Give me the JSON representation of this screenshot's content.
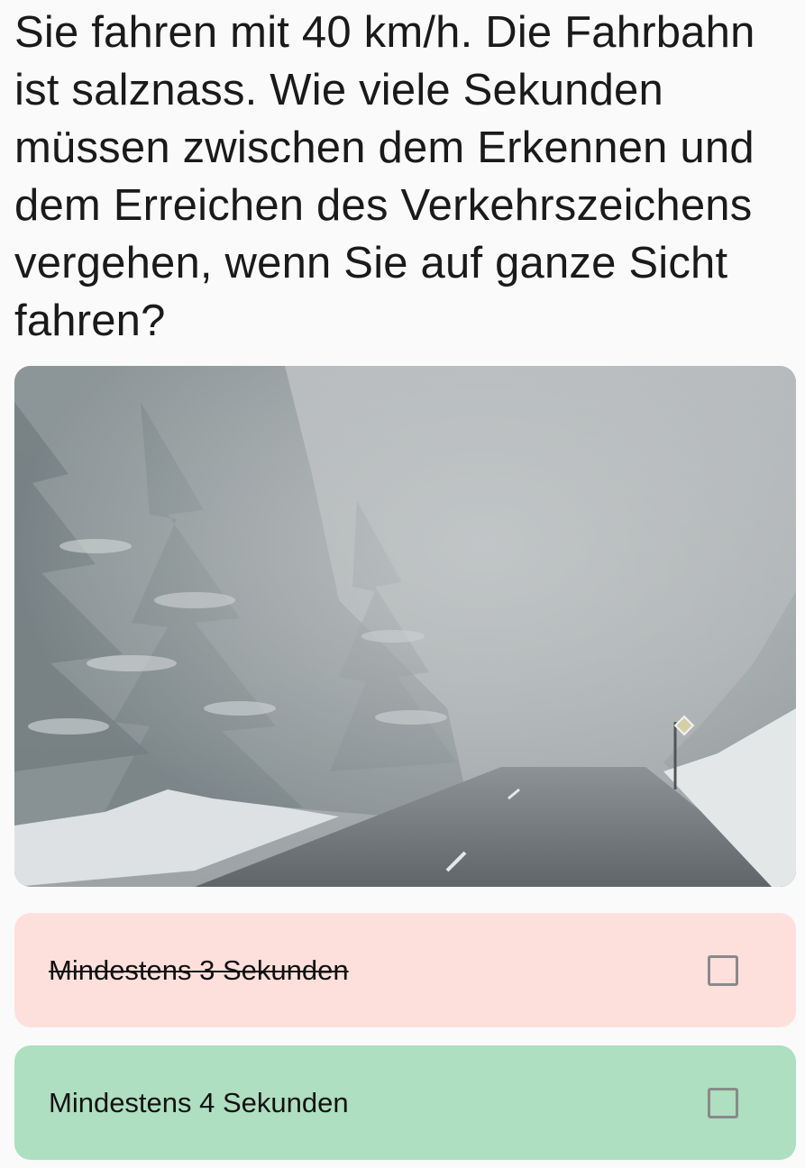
{
  "question": {
    "text": "Sie fahren mit 40 km/h. Die Fahrbahn ist salznass. Wie viele Sekunden müssen zwischen dem Erkennen und dem Erreichen des Verkehrszeichens vergehen, wenn Sie auf ganze Sicht fahren?"
  },
  "image": {
    "description_icon": "foggy-snowy-road-photo"
  },
  "answers": [
    {
      "label": "Mindestens 3 Sekunden",
      "state": "wrong",
      "checked": false
    },
    {
      "label": "Mindestens 4 Sekunden",
      "state": "correct",
      "checked": false
    }
  ],
  "colors": {
    "wrong_bg": "#fde0dc",
    "correct_bg": "#addfc0",
    "checkbox_border": "#8a8a8a"
  }
}
